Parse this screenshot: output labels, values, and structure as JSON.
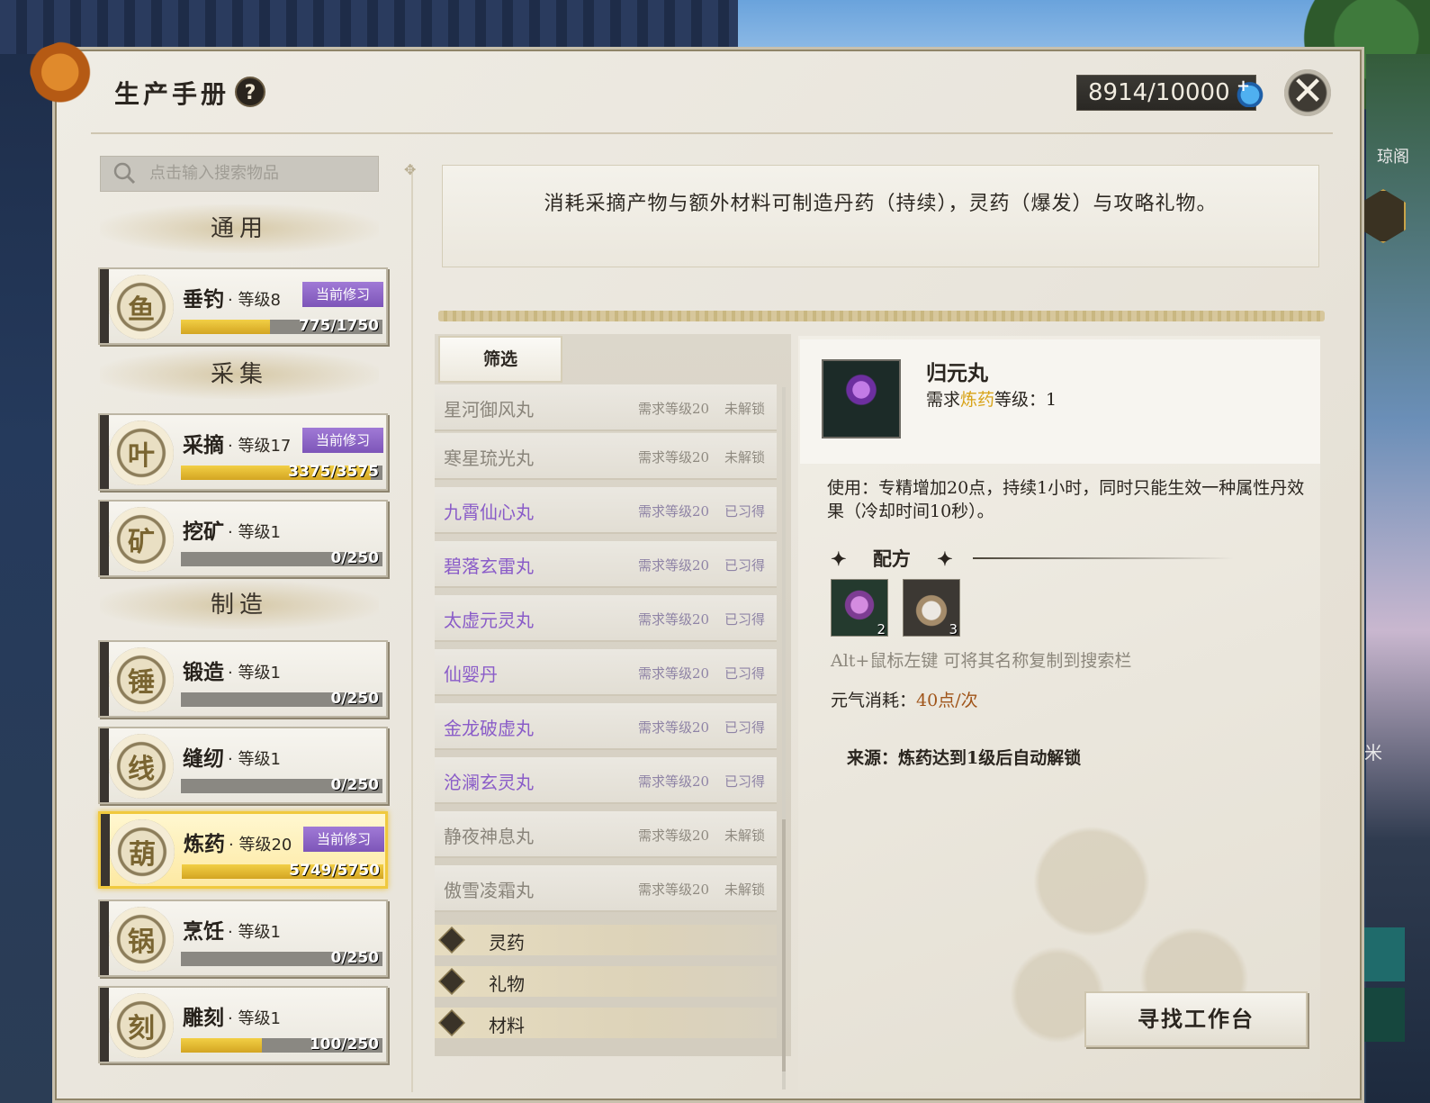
{
  "header": {
    "title": "生产手册",
    "help_icon": "?",
    "energy": "8914/10000",
    "energy_add_icon": "+",
    "close_icon": "✕"
  },
  "sidebar": {
    "search_placeholder": "点击输入搜索物品",
    "sections": {
      "general": "通用",
      "gather": "采集",
      "craft": "制造"
    },
    "current_badge": "当前修习",
    "skills": [
      {
        "name": "垂钓",
        "level": "· 等级8",
        "progress": "775/1750",
        "fill": 0.44,
        "current": true,
        "icon": "fishing-rod-icon"
      },
      {
        "name": "采摘",
        "level": "· 等级17",
        "progress": "3375/3575",
        "fill": 0.94,
        "current": true,
        "icon": "herb-leaf-icon"
      },
      {
        "name": "挖矿",
        "level": "· 等级1",
        "progress": "0/250",
        "fill": 0.0,
        "current": false,
        "icon": "ore-crystal-icon"
      },
      {
        "name": "锻造",
        "level": "· 等级1",
        "progress": "0/250",
        "fill": 0.0,
        "current": false,
        "icon": "anvil-icon"
      },
      {
        "name": "缝纫",
        "level": "· 等级1",
        "progress": "0/250",
        "fill": 0.0,
        "current": false,
        "icon": "yarn-ball-icon"
      },
      {
        "name": "炼药",
        "level": "· 等级20",
        "progress": "5749/5750",
        "fill": 1.0,
        "current": true,
        "active": true,
        "icon": "gourd-icon"
      },
      {
        "name": "烹饪",
        "level": "· 等级1",
        "progress": "0/250",
        "fill": 0.0,
        "current": false,
        "icon": "cooking-pot-icon"
      },
      {
        "name": "雕刻",
        "level": "· 等级1",
        "progress": "100/250",
        "fill": 0.4,
        "current": false,
        "icon": "chisel-icon"
      }
    ]
  },
  "description": "消耗采摘产物与额外材料可制造丹药（持续），灵药（爆发）与攻略礼物。",
  "list": {
    "filter_label": "筛选",
    "items": [
      {
        "name": "星河御风丸",
        "req": "需求等级20",
        "status": "未解锁",
        "state": "locked"
      },
      {
        "name": "寒星琉光丸",
        "req": "需求等级20",
        "status": "未解锁",
        "state": "locked"
      },
      {
        "name": "九霄仙心丸",
        "req": "需求等级20",
        "status": "已习得",
        "state": "learned"
      },
      {
        "name": "碧落玄雷丸",
        "req": "需求等级20",
        "status": "已习得",
        "state": "learned"
      },
      {
        "name": "太虚元灵丸",
        "req": "需求等级20",
        "status": "已习得",
        "state": "learned"
      },
      {
        "name": "仙婴丹",
        "req": "需求等级20",
        "status": "已习得",
        "state": "learned"
      },
      {
        "name": "金龙破虚丸",
        "req": "需求等级20",
        "status": "已习得",
        "state": "learned"
      },
      {
        "name": "沧澜玄灵丸",
        "req": "需求等级20",
        "status": "已习得",
        "state": "learned"
      },
      {
        "name": "静夜神息丸",
        "req": "需求等级20",
        "status": "未解锁",
        "state": "locked"
      },
      {
        "name": "傲雪凌霜丸",
        "req": "需求等级20",
        "status": "未解锁",
        "state": "locked"
      }
    ],
    "categories": [
      "灵药",
      "礼物",
      "材料"
    ]
  },
  "detail": {
    "item_name": "归元丸",
    "req_prefix": "需求",
    "req_skill": "炼药",
    "req_suffix": "等级：1",
    "use_text": "使用：专精增加20点，持续1小时，同时只能生效一种属性丹效果（冷却时间10秒）。",
    "recipe_title": "配方",
    "materials": [
      {
        "icon": "flower-petal-icon",
        "count": "2"
      },
      {
        "icon": "powder-pile-icon",
        "count": "3"
      }
    ],
    "hint": "Alt+鼠标左键 可将其名称复制到搜索栏",
    "cost_label": "元气消耗：",
    "cost_value": "40点/次",
    "source": "来源：炼药达到1级后自动解锁",
    "find_button": "寻找工作台"
  },
  "background": {
    "right_label": "琼阁",
    "right_char": "米"
  }
}
